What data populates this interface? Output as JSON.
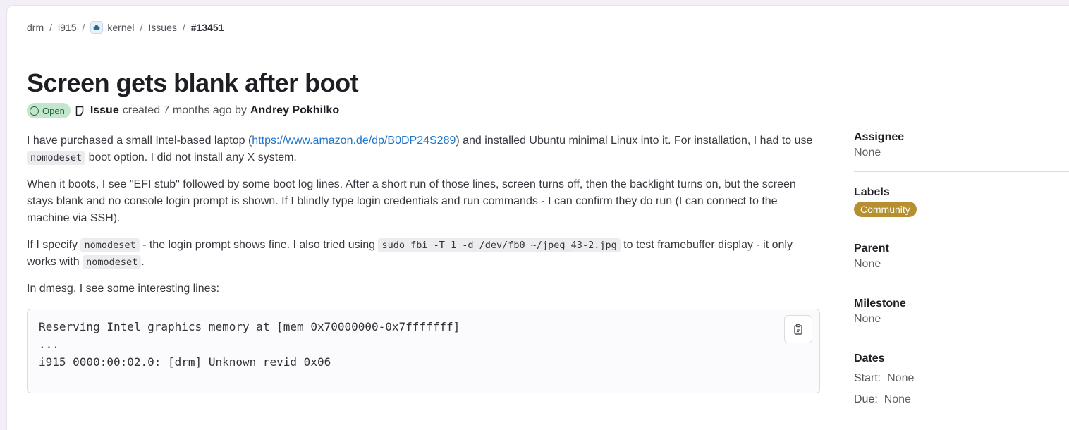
{
  "breadcrumb": {
    "items": [
      "drm",
      "i915",
      "kernel",
      "Issues",
      "#13451"
    ],
    "separator": "/"
  },
  "issue": {
    "title": "Screen gets blank after boot",
    "status": "Open",
    "type": "Issue",
    "created_text": "created 7 months ago by",
    "author": "Andrey Pokhilko"
  },
  "description": {
    "p1": {
      "before_link": "I have purchased a small Intel-based laptop (",
      "link": "https://www.amazon.de/dp/B0DP24S289",
      "after_link": ") and installed Ubuntu minimal Linux into it. For installation, I had to use ",
      "code": "nomodeset",
      "end": " boot option. I did not install any X system."
    },
    "p2": "When it boots, I see \"EFI stub\" followed by some boot log lines. After a short run of those lines, screen turns off, then the backlight turns on, but the screen stays blank and no console login prompt is shown. If I blindly type login credentials and run commands - I can confirm they do run (I can connect to the machine via SSH).",
    "p3": {
      "a": "If I specify ",
      "code1": "nomodeset",
      "b": " - the login prompt shows fine. I also tried using ",
      "code2": "sudo fbi -T 1 -d /dev/fb0 ~/jpeg_43-2.jpg",
      "c": " to test framebuffer display - it only works with ",
      "code3": "nomodeset",
      "d": "."
    },
    "p4": "In dmesg, I see some interesting lines:",
    "code_lines": [
      "Reserving Intel graphics memory at [mem 0x70000000-0x7fffffff]",
      "...",
      "i915 0000:00:02.0: [drm] Unknown revid 0x06"
    ]
  },
  "sidebar": {
    "assignee": {
      "title": "Assignee",
      "value": "None"
    },
    "labels": {
      "title": "Labels",
      "items": [
        "Community"
      ]
    },
    "parent": {
      "title": "Parent",
      "value": "None"
    },
    "milestone": {
      "title": "Milestone",
      "value": "None"
    },
    "dates": {
      "title": "Dates",
      "start_label": "Start:",
      "start_value": "None",
      "due_label": "Due:",
      "due_value": "None"
    }
  },
  "colors": {
    "link": "#1f75cb",
    "open_badge_bg": "#c3e6cd",
    "open_badge_fg": "#24663b",
    "label_community": "#b58f30"
  },
  "icons": [
    "project-avatar-icon",
    "status-open-icon",
    "issue-type-icon",
    "copy-icon"
  ]
}
